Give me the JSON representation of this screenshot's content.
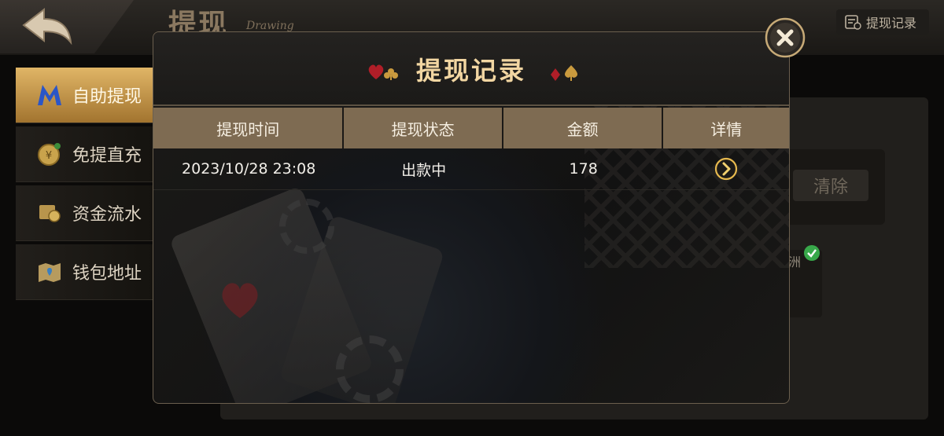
{
  "header": {
    "title": "提现",
    "subtitle": "Drawing",
    "history_button_label": "提现记录"
  },
  "sidebar": {
    "items": [
      {
        "label": "自助提现",
        "active": true
      },
      {
        "label": "免提直充",
        "active": false
      },
      {
        "label": "资金流水",
        "active": false
      },
      {
        "label": "钱包地址",
        "active": false
      }
    ]
  },
  "background": {
    "clear_button_label": "清除",
    "card_label": "洲"
  },
  "modal": {
    "title": "提现记录",
    "columns": [
      "提现时间",
      "提现状态",
      "金额",
      "详情"
    ],
    "rows": [
      {
        "time": "2023/10/28 23:08",
        "status": "出款中",
        "amount": "178"
      }
    ]
  },
  "colors": {
    "accent_gold": "#e0b566",
    "header_bar": "#7e6b52",
    "title_text": "#f2d6a2"
  }
}
